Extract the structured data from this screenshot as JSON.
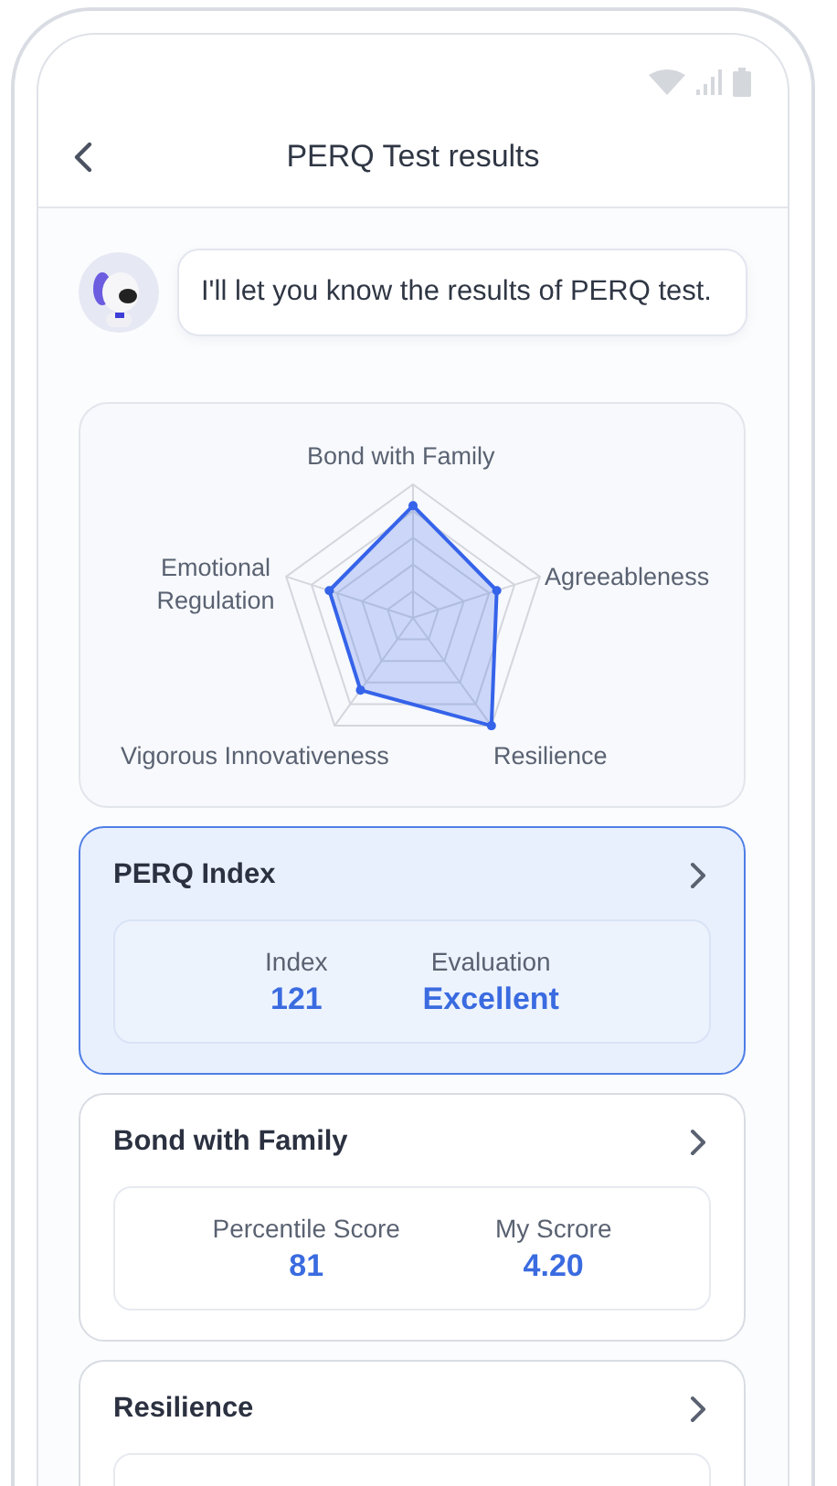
{
  "header": {
    "title": "PERQ Test results"
  },
  "message": {
    "text": "I'll let you know the results of PERQ test."
  },
  "radar": {
    "labels": [
      "Bond with Family",
      "Emotional Regulation",
      "Agreeableness",
      "Vigorous Innovativeness",
      "Resilience"
    ]
  },
  "cards": [
    {
      "title": "PERQ Index",
      "selected": true,
      "stats": [
        {
          "label": "Index",
          "value": "121"
        },
        {
          "label": "Evaluation",
          "value": "Excellent"
        }
      ]
    },
    {
      "title": "Bond with Family",
      "selected": false,
      "stats": [
        {
          "label": "Percentile Score",
          "value": "81"
        },
        {
          "label": "My Scrore",
          "value": "4.20"
        }
      ]
    },
    {
      "title": "Resilience",
      "selected": false
    }
  ]
}
